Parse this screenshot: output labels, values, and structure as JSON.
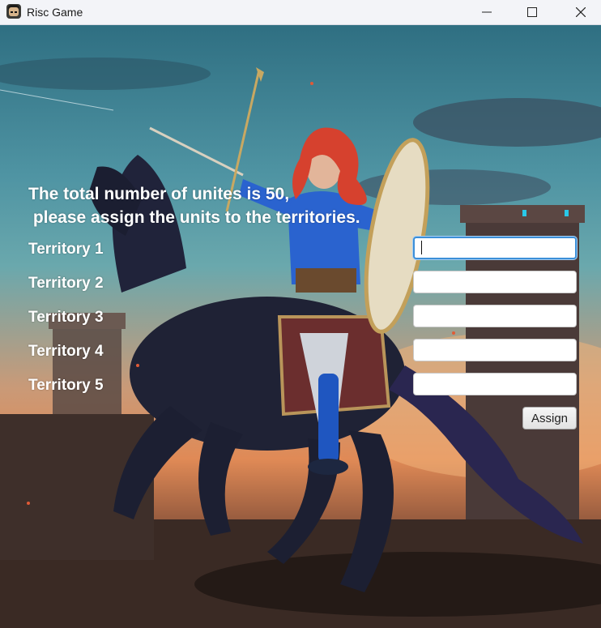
{
  "window": {
    "title": "Risc Game",
    "icon": "risc-game-app-icon",
    "controls": [
      "minimize-icon",
      "maximize-icon",
      "close-icon"
    ]
  },
  "form": {
    "heading": "The total number of unites is 50,\n please assign the units to the territories.",
    "territories": [
      {
        "label": "Territory 1",
        "value": ""
      },
      {
        "label": "Territory 2",
        "value": ""
      },
      {
        "label": "Territory 3",
        "value": ""
      },
      {
        "label": "Territory 4",
        "value": ""
      },
      {
        "label": "Territory 5",
        "value": ""
      }
    ],
    "focused_field": 1,
    "assign_label": "Assign"
  }
}
